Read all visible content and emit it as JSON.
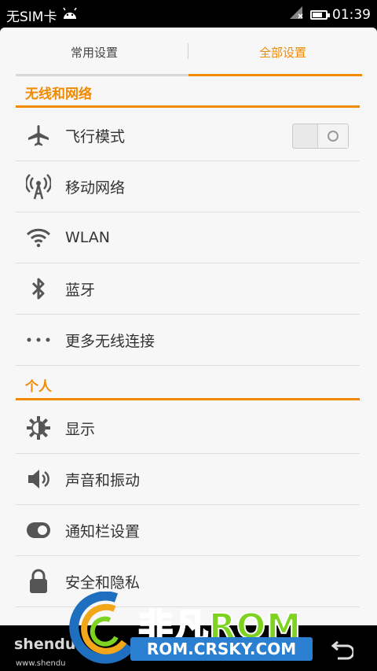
{
  "status_bar": {
    "sim_text": "无SIM卡",
    "time": "01:39",
    "battery_level": 0.75
  },
  "tabs": [
    {
      "label": "常用设置",
      "active": false
    },
    {
      "label": "全部设置",
      "active": true
    }
  ],
  "sections": [
    {
      "header": "无线和网络",
      "items": [
        {
          "label": "飞行模式",
          "icon": "airplane-icon",
          "toggle": false
        },
        {
          "label": "移动网络",
          "icon": "mobile-network-icon"
        },
        {
          "label": "WLAN",
          "icon": "wifi-icon"
        },
        {
          "label": "蓝牙",
          "icon": "bluetooth-icon"
        },
        {
          "label": "更多无线连接",
          "icon": "more-dots-icon"
        }
      ]
    },
    {
      "header": "个人",
      "items": [
        {
          "label": "显示",
          "icon": "display-icon"
        },
        {
          "label": "声音和振动",
          "icon": "speaker-icon"
        },
        {
          "label": "通知栏设置",
          "icon": "notification-toggle-icon"
        },
        {
          "label": "安全和隐私",
          "icon": "lock-icon"
        }
      ]
    }
  ],
  "watermark": {
    "left_brand": "shendu",
    "left_url": "www.shendu",
    "brand": "非凡",
    "brand_rom": "ROM",
    "url": "ROM.CRSKY.COM"
  },
  "colors": {
    "accent": "#f08a00",
    "background": "#f7f7f7",
    "text": "#333333"
  }
}
